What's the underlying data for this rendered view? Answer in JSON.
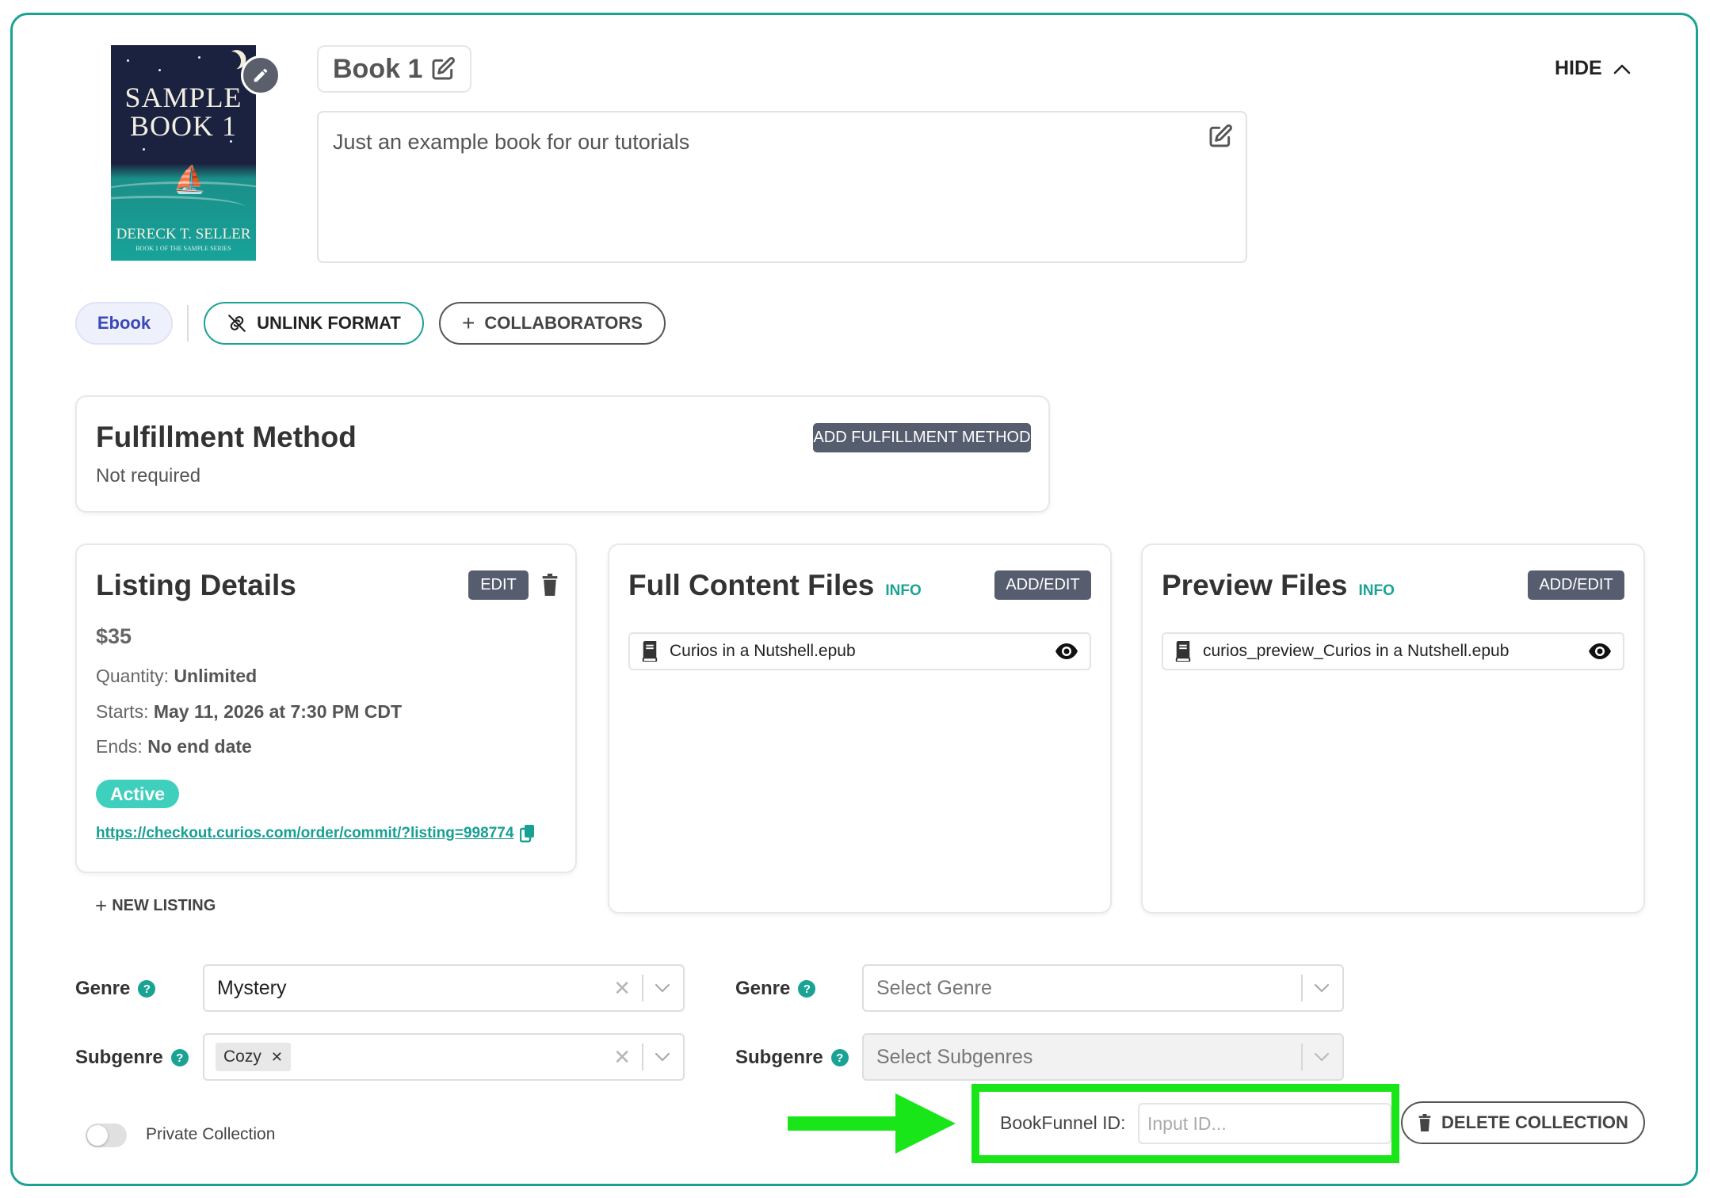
{
  "book": {
    "cover": {
      "title_line1": "SAMPLE",
      "title_line2": "BOOK 1",
      "author": "DERECK T. SELLER",
      "series": "BOOK 1 OF THE SAMPLE SERIES"
    },
    "title": "Book 1",
    "description": "Just an example book for our tutorials"
  },
  "header": {
    "hide_label": "HIDE"
  },
  "format_bar": {
    "format": "Ebook",
    "unlink_label": "UNLINK FORMAT",
    "collaborators_label": "COLLABORATORS"
  },
  "fulfillment": {
    "title": "Fulfillment Method",
    "status": "Not required",
    "add_label": "ADD FULFILLMENT METHOD"
  },
  "listing": {
    "title": "Listing Details",
    "edit_label": "EDIT",
    "price": "$35",
    "quantity_label": "Quantity:",
    "quantity_value": "Unlimited",
    "starts_label": "Starts:",
    "starts_value": "May 11, 2026 at 7:30 PM CDT",
    "ends_label": "Ends:",
    "ends_value": "No end date",
    "status": "Active",
    "link": "https://checkout.curios.com/order/commit/?listing=998774",
    "new_listing_label": "NEW LISTING"
  },
  "full_content": {
    "title": "Full Content Files",
    "info": "INFO",
    "add_label": "ADD/EDIT",
    "file": "Curios in a Nutshell.epub"
  },
  "preview": {
    "title": "Preview Files",
    "info": "INFO",
    "add_label": "ADD/EDIT",
    "file": "curios_preview_Curios in a Nutshell.epub"
  },
  "left_fields": {
    "genre_label": "Genre",
    "genre_value": "Mystery",
    "subgenre_label": "Subgenre",
    "subgenre_chip": "Cozy"
  },
  "right_fields": {
    "genre_label": "Genre",
    "genre_placeholder": "Select Genre",
    "subgenre_label": "Subgenre",
    "subgenre_placeholder": "Select Subgenres"
  },
  "footer": {
    "private_label": "Private Collection",
    "bookfunnel_label": "BookFunnel ID:",
    "bookfunnel_placeholder": "Input ID...",
    "delete_label": "DELETE COLLECTION"
  },
  "colors": {
    "accent": "#1aa394",
    "highlight": "#19e619",
    "dark_button": "#555d6e"
  }
}
